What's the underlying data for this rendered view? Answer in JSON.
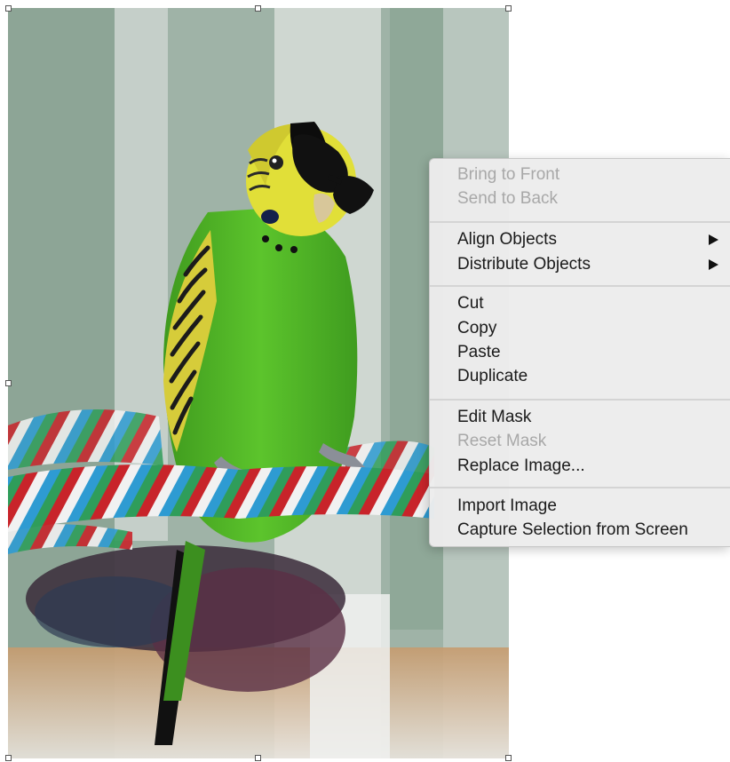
{
  "context_menu": {
    "groups": [
      {
        "items": [
          {
            "label": "Bring to Front",
            "enabled": false
          },
          {
            "label": "Send to Back",
            "enabled": false
          }
        ]
      },
      {
        "items": [
          {
            "label": "Align Objects",
            "enabled": true,
            "submenu": true
          },
          {
            "label": "Distribute Objects",
            "enabled": true,
            "submenu": true
          }
        ]
      },
      {
        "items": [
          {
            "label": "Cut",
            "enabled": true
          },
          {
            "label": "Copy",
            "enabled": true
          },
          {
            "label": "Paste",
            "enabled": true
          },
          {
            "label": "Duplicate",
            "enabled": true
          }
        ]
      },
      {
        "items": [
          {
            "label": "Edit Mask",
            "enabled": true
          },
          {
            "label": "Reset Mask",
            "enabled": false
          },
          {
            "label": "Replace Image...",
            "enabled": true
          }
        ]
      },
      {
        "items": [
          {
            "label": "Import Image",
            "enabled": true
          },
          {
            "label": "Capture Selection from Screen",
            "enabled": true
          }
        ]
      }
    ]
  },
  "image_object": {
    "subject": "budgerigar-wearing-sunglasses-on-rope-perch",
    "selected": true
  },
  "colors": {
    "menu_background": "#ececec",
    "menu_text": "#1a1a1a",
    "menu_text_disabled": "#a8a8a8",
    "bird_green": "#55b92a",
    "bird_yellow": "#e6e43c"
  }
}
